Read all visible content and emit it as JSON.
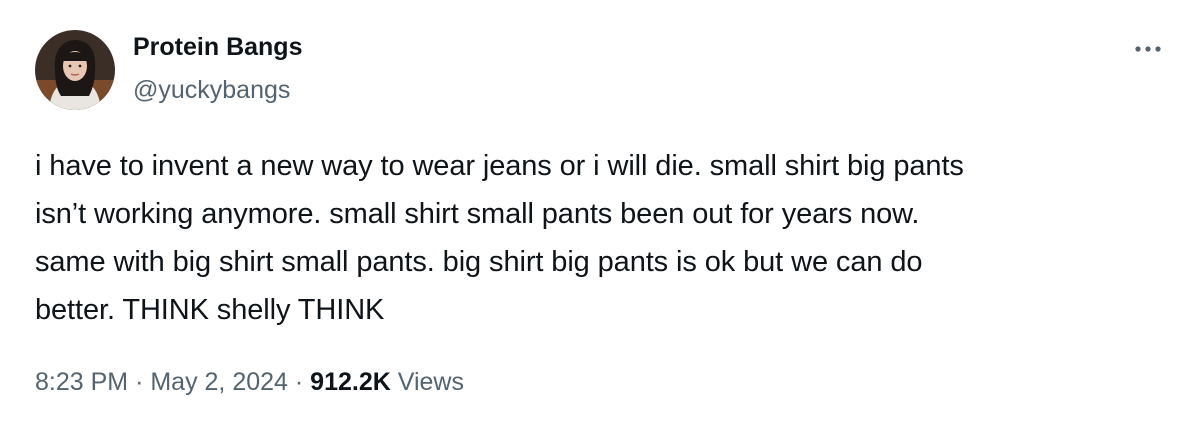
{
  "author": {
    "name": "Protein Bangs",
    "handle": "@yuckybangs",
    "avatar_icon": "profile-photo"
  },
  "more_icon": "more-horizontal-icon",
  "tweet": {
    "text": "i have to invent a new way to wear jeans or i will die. small shirt big pants\nisn’t working anymore. small shirt small pants been out for years now.\nsame with big shirt small pants. big shirt big pants is ok but we can do\nbetter. THINK shelly THINK"
  },
  "meta": {
    "time": "8:23 PM",
    "separator": "·",
    "date": "May 2, 2024",
    "views_count": "912.2K",
    "views_label": "Views"
  },
  "colors": {
    "text": "#0f1419",
    "secondary": "#536471",
    "background": "#ffffff"
  }
}
